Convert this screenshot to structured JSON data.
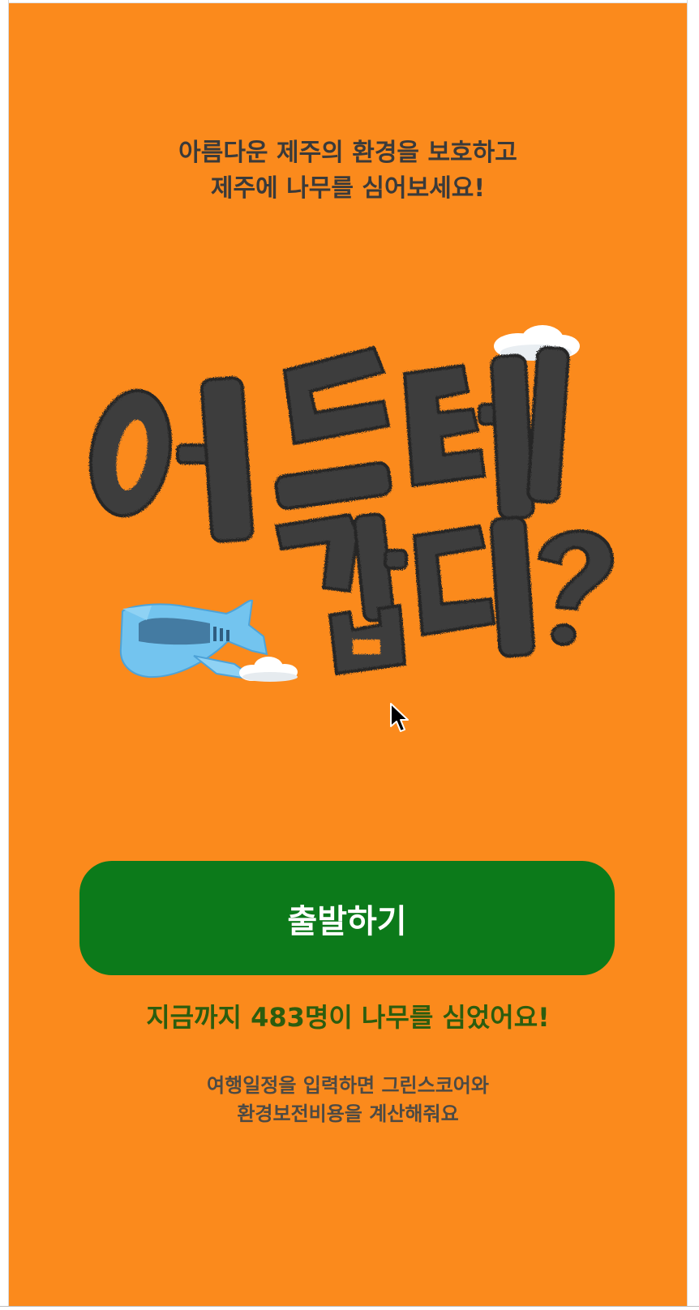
{
  "intro": {
    "line1": "아름다운 제주의 환경을 보호하고",
    "line2": "제주에 나무를 심어보세요!"
  },
  "hero": {
    "title_line1": "어드레",
    "title_line2": "갑디?",
    "illustration_icons": [
      "airplane-icon",
      "cloud-icon"
    ]
  },
  "start_button": {
    "label": "출발하기"
  },
  "counter": {
    "text": "지금까지 483명이 나무를 심었어요!",
    "count": 483
  },
  "info": {
    "line1": "여행일정을 입력하면 그린스코어와",
    "line2": "환경보전비용을 계산해줘요"
  },
  "colors": {
    "background": "#fb8a1c",
    "button": "#0c7a1a",
    "counter_text": "#2c5d0e",
    "title_letters": "#3d3d3d",
    "airplane": "#6ec1ee"
  }
}
